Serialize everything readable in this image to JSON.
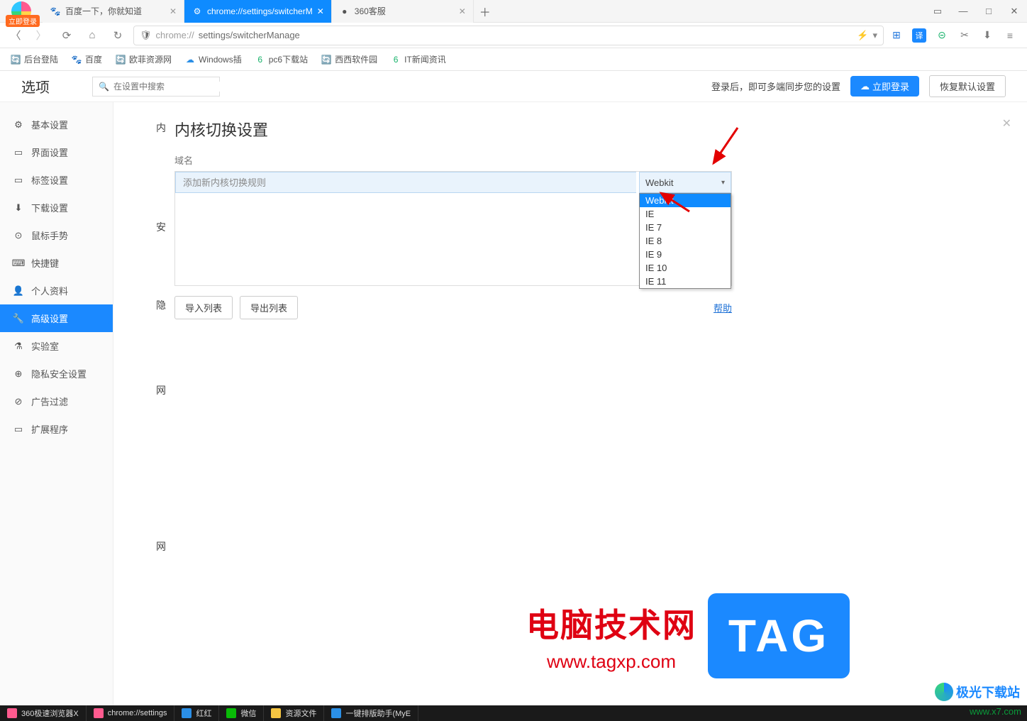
{
  "titlebar": {
    "login_badge": "立即登录",
    "tabs": [
      {
        "title": "百度一下，你就知道",
        "icon": "🐾"
      },
      {
        "title": "chrome://settings/switcherM",
        "icon": "⚙",
        "active": true
      },
      {
        "title": "360客服",
        "icon": "●"
      }
    ],
    "window_buttons": [
      "▭",
      "—",
      "□",
      "✕"
    ]
  },
  "addrbar": {
    "shield": "🛡",
    "protocol": "chrome://",
    "path": "settings/switcherManage",
    "right_icons": [
      "⚡",
      "▾",
      "⊞",
      "译",
      "⊝",
      "✂",
      "⬇",
      "≡"
    ]
  },
  "bookmarks": [
    {
      "icon": "🔄",
      "label": "后台登陆",
      "color": "#17b26a"
    },
    {
      "icon": "🐾",
      "label": "百度",
      "color": "#3b5bdb"
    },
    {
      "icon": "🔄",
      "label": "欧菲资源网",
      "color": "#17b26a"
    },
    {
      "icon": "☁",
      "label": "Windows插",
      "color": "#2b8fe6"
    },
    {
      "icon": "6",
      "label": "pc6下载站",
      "color": "#17b26a"
    },
    {
      "icon": "🔄",
      "label": "西西软件园",
      "color": "#17b26a"
    },
    {
      "icon": "6",
      "label": "IT新闻资讯",
      "color": "#17b26a"
    }
  ],
  "page": {
    "title": "选项",
    "search_placeholder": "在设置中搜索",
    "sync_text": "登录后，即可多端同步您的设置",
    "login_btn": "立即登录",
    "restore_btn": "恢复默认设置"
  },
  "sidebar": [
    {
      "icon": "⚙",
      "label": "基本设置"
    },
    {
      "icon": "▭",
      "label": "界面设置"
    },
    {
      "icon": "▭",
      "label": "标签设置"
    },
    {
      "icon": "⬇",
      "label": "下载设置"
    },
    {
      "icon": "⊙",
      "label": "鼠标手势"
    },
    {
      "icon": "⌨",
      "label": "快捷键"
    },
    {
      "icon": "👤",
      "label": "个人资料"
    },
    {
      "icon": "🔧",
      "label": "高级设置",
      "active": true
    },
    {
      "icon": "⚗",
      "label": "实验室"
    },
    {
      "icon": "⊕",
      "label": "隐私安全设置"
    },
    {
      "icon": "⊘",
      "label": "广告过滤"
    },
    {
      "icon": "▭",
      "label": "扩展程序"
    }
  ],
  "sections": [
    "内",
    "安",
    "隐",
    "网",
    "网"
  ],
  "dialog": {
    "title": "内核切换设置",
    "domain_label": "域名",
    "domain_placeholder": "添加新内核切换规则",
    "select_value": "Webkit",
    "options": [
      "Webkit",
      "IE",
      "IE 7",
      "IE 8",
      "IE 9",
      "IE 10",
      "IE 11"
    ],
    "selected_index": 0,
    "import_btn": "导入列表",
    "export_btn": "导出列表",
    "help": "帮助"
  },
  "watermark": {
    "cn": "电脑技术网",
    "url": "www.tagxp.com",
    "tag": "TAG",
    "jiguang": "极光下载站",
    "x7": "www.x7.com"
  },
  "taskbar": [
    {
      "label": "360极速浏览器X",
      "color": "#ff5b8f"
    },
    {
      "label": "chrome://settings",
      "color": "#ff5b8f"
    },
    {
      "label": "红红",
      "color": "#2b8fe6"
    },
    {
      "label": "微信",
      "color": "#09bb07"
    },
    {
      "label": "资源文件",
      "color": "#f5c542"
    },
    {
      "label": "一键排版助手(MyE",
      "color": "#2b8fe6"
    }
  ]
}
